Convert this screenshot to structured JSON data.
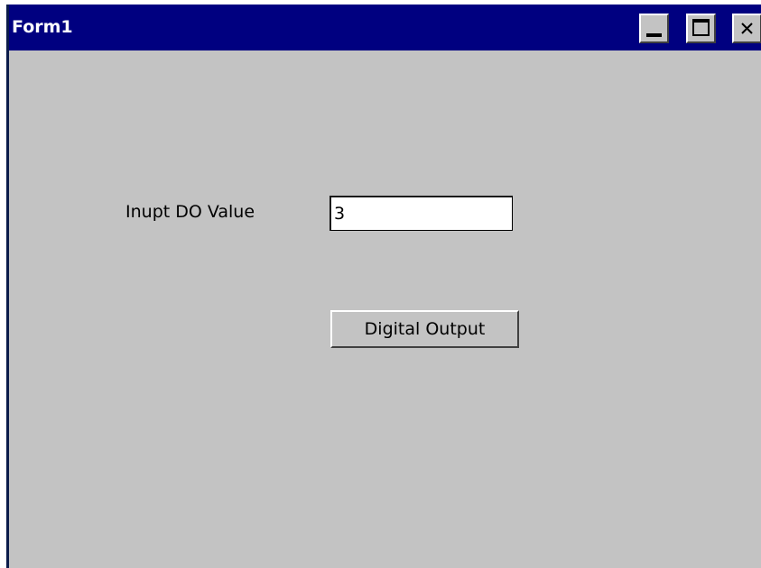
{
  "window": {
    "title": "Form1",
    "controls": {
      "minimize_icon": "minimize-icon",
      "maximize_icon": "maximize-icon",
      "close_icon": "close-icon"
    }
  },
  "form": {
    "do_value_label": "Inupt DO Value",
    "do_value_input": "3",
    "digital_output_button": "Digital Output"
  },
  "colors": {
    "titlebar": "#000080",
    "title_text": "#ffffff",
    "client_area": "#c3c3c3",
    "input_background": "#ffffff"
  }
}
